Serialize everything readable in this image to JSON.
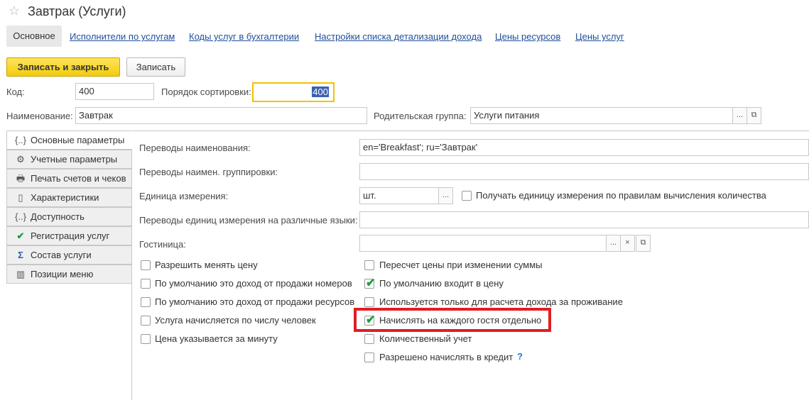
{
  "window": {
    "title": "Завтрак (Услуги)"
  },
  "tabs": [
    {
      "label": "Основное"
    },
    {
      "label": "Исполнители по услугам"
    },
    {
      "label": "Коды услуг в бухгалтерии"
    },
    {
      "label": "Настройки списка детализации дохода"
    },
    {
      "label": "Цены ресурсов"
    },
    {
      "label": "Цены услуг"
    }
  ],
  "toolbar": {
    "save_close": "Записать и закрыть",
    "save": "Записать"
  },
  "form": {
    "code_label": "Код:",
    "code_value": "400",
    "sort_label": "Порядок сортировки:",
    "sort_value": "400",
    "name_label": "Наименование:",
    "name_value": "Завтрак",
    "parent_label": "Родительская группа:",
    "parent_value": "Услуги питания"
  },
  "side_tabs": [
    {
      "label": "Основные параметры",
      "icon": "braces-icon"
    },
    {
      "label": "Учетные параметры",
      "icon": "gear-icon"
    },
    {
      "label": "Печать счетов и чеков",
      "icon": "printer-icon"
    },
    {
      "label": "Характеристики",
      "icon": "document-icon"
    },
    {
      "label": "Доступность",
      "icon": "braces-icon"
    },
    {
      "label": "Регистрация услуг",
      "icon": "checkmark-icon"
    },
    {
      "label": "Состав услуги",
      "icon": "sigma-icon"
    },
    {
      "label": "Позиции меню",
      "icon": "bottles-icon"
    }
  ],
  "params": {
    "translations_label": "Переводы наименования:",
    "translations_value": "en='Breakfast'; ru='Завтрак'",
    "group_translations_label": "Переводы наимен. группировки:",
    "group_translations_value": "",
    "unit_label": "Единица измерения:",
    "unit_value": "шт.",
    "unit_rule_label": "Получать единицу измерения по правилам вычисления количества",
    "unit_translations_label": "Переводы единиц измерения на различные языки:",
    "unit_translations_value": "",
    "hotel_label": "Гостиница:",
    "hotel_value": ""
  },
  "checkboxes_left": [
    {
      "label": "Разрешить менять цену",
      "checked": false
    },
    {
      "label": "По умолчанию это доход от продажи номеров",
      "checked": false
    },
    {
      "label": "По умолчанию это доход от продажи ресурсов",
      "checked": false
    },
    {
      "label": "Услуга начисляется по числу человек",
      "checked": false
    },
    {
      "label": "Цена указывается за минуту",
      "checked": false
    }
  ],
  "checkboxes_right": [
    {
      "label": "Пересчет цены при изменении суммы",
      "checked": false
    },
    {
      "label": "По умолчанию входит в цену",
      "checked": true
    },
    {
      "label": "Используется только для расчета дохода за проживание",
      "checked": false
    },
    {
      "label": "Начислять на каждого гостя отдельно",
      "checked": true
    },
    {
      "label": "Количественный учет",
      "checked": false
    },
    {
      "label": "Разрешено начислять в кредит",
      "checked": false
    }
  ],
  "help_mark": "?",
  "colors": {
    "accent_yellow": "#f3cc0c",
    "link": "#1f4e9b",
    "check_green": "#1e9b3c",
    "highlight_red": "#e01e24"
  }
}
